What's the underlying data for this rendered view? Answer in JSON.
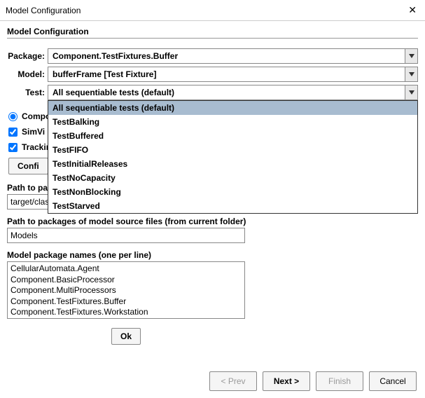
{
  "window": {
    "title": "Model Configuration",
    "close": "✕"
  },
  "header": {
    "title": "Model Configuration"
  },
  "form": {
    "package_label": "Package:",
    "package_value": "Component.TestFixtures.Buffer",
    "model_label": "Model:",
    "model_value": "bufferFrame [Test Fixture]",
    "test_label": "Test:",
    "test_value": "All sequentiable tests (default)",
    "test_options": [
      "All sequentiable tests (default)",
      "TestBalking",
      "TestBuffered",
      "TestFIFO",
      "TestInitialReleases",
      "TestNoCapacity",
      "TestNonBlocking",
      "TestStarved"
    ]
  },
  "options": {
    "radio_component_partial": "Compo",
    "check_simview_partial": "SimVi",
    "check_tracking_partial": "Trackin",
    "configure_partial": "Confi"
  },
  "paths": {
    "classes_label": "Path to packages of model classes (from current folder)",
    "classes_value": "target/classes",
    "sources_label": "Path to packages of model source files (from current folder)",
    "sources_value": "Models",
    "packages_label": "Model package names (one per line)",
    "packages_value": "CellularAutomata.Agent\nComponent.BasicProcessor\nComponent.MultiProcessors\nComponent.TestFixtures.Buffer\nComponent.TestFixtures.Workstation"
  },
  "buttons": {
    "ok": "Ok",
    "prev": "< Prev",
    "next": "Next >",
    "finish": "Finish",
    "cancel": "Cancel"
  }
}
